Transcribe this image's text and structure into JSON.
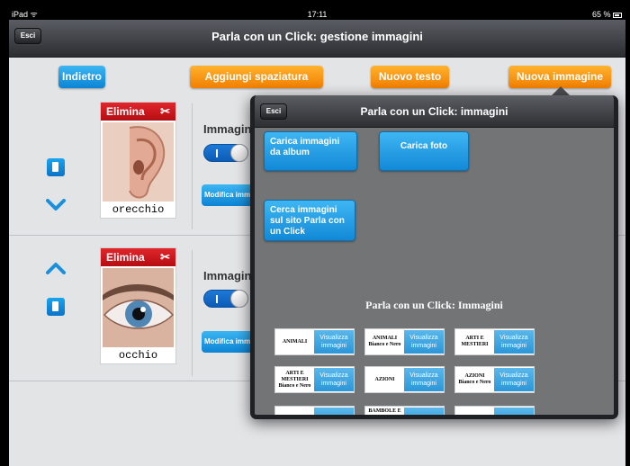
{
  "status_bar": {
    "device": "iPad",
    "wifi": "ᯤ",
    "time": "17:11",
    "battery": "65 %"
  },
  "nav": {
    "exit_label": "Esci",
    "title": "Parla con un Click: gestione immagini"
  },
  "toolbar": {
    "back_label": "Indietro",
    "add_spacing_label": "Aggiungi spaziatura",
    "new_text_label": "Nuovo testo",
    "new_image_label": "Nuova immagine"
  },
  "items": [
    {
      "delete_label": "Elimina",
      "word": "orecchio",
      "images_label": "Immagini",
      "edit_label": "Modifica immagine"
    },
    {
      "delete_label": "Elimina",
      "word": "occhio",
      "images_label": "Immagini",
      "edit_label": "Modifica immagine"
    }
  ],
  "popover": {
    "exit_label": "Esci",
    "title": "Parla con un Click: immagini",
    "load_album_label": "Carica immagini da album",
    "load_photo_label": "Carica foto",
    "search_site_label": "Cerca immagini sul sito Parla con un Click",
    "web_title": "Parla con un Click: Immagini",
    "view_label": "Visualizza immagini",
    "categories": [
      {
        "name": "ANIMALI"
      },
      {
        "name": "ANIMALI",
        "sub": "Bianco e Nero"
      },
      {
        "name": "ARTI E MESTIERI"
      },
      {
        "name": "ARTI E MESTIERI",
        "sub": "Bianco e Nero"
      },
      {
        "name": "AZIONI"
      },
      {
        "name": "AZIONI",
        "sub": "Bianco e Nero"
      },
      {
        "name": ""
      },
      {
        "name": "BAMBOLE E"
      },
      {
        "name": ""
      }
    ]
  },
  "colors": {
    "blue": "#0c84d4",
    "orange": "#f17f02",
    "red": "#c3161c"
  }
}
